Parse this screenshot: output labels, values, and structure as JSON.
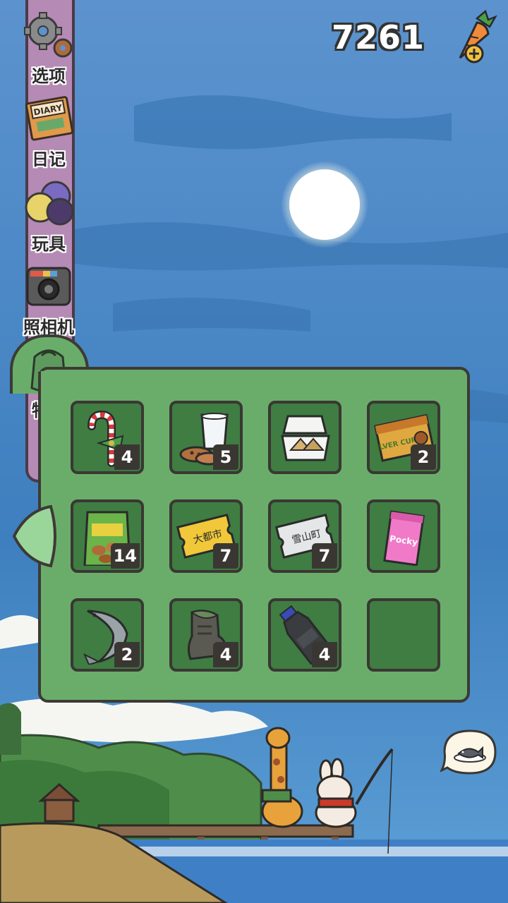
{
  "sidebar": {
    "items": [
      {
        "label": "选项",
        "icon": "gear-icon"
      },
      {
        "label": "日记",
        "icon": "diary-icon"
      },
      {
        "label": "玩具",
        "icon": "toy-balls-icon"
      },
      {
        "label": "照相机",
        "icon": "camera-icon"
      },
      {
        "label": "物品",
        "icon": "backpack-icon"
      }
    ],
    "diary_cover_text": "DIARY"
  },
  "currency": {
    "carrots": "7261",
    "icon": "carrot-plus-icon"
  },
  "inventory": {
    "slots": [
      {
        "item": "candy-cane",
        "count": "4"
      },
      {
        "item": "milk-and-cookies",
        "count": "5"
      },
      {
        "item": "sandwich-box",
        "count": ""
      },
      {
        "item": "silver-curry-box",
        "count": "2",
        "text": "SILVER CURRY"
      },
      {
        "item": "snack-bag",
        "count": "14"
      },
      {
        "item": "gold-train-ticket",
        "count": "7",
        "text": "大都市"
      },
      {
        "item": "silver-train-ticket",
        "count": "7",
        "text": "雪山町"
      },
      {
        "item": "pocky-box",
        "count": "",
        "text": "Pocky"
      },
      {
        "item": "sturgeon-fish",
        "count": "2"
      },
      {
        "item": "old-boot",
        "count": "4"
      },
      {
        "item": "plastic-bottle",
        "count": "4"
      },
      {
        "item": "empty",
        "count": ""
      }
    ]
  },
  "colors": {
    "panel": "#6aad6a",
    "slot": "#3f7d43",
    "sky": "#4b86c3",
    "water": "#3f7fc6"
  }
}
